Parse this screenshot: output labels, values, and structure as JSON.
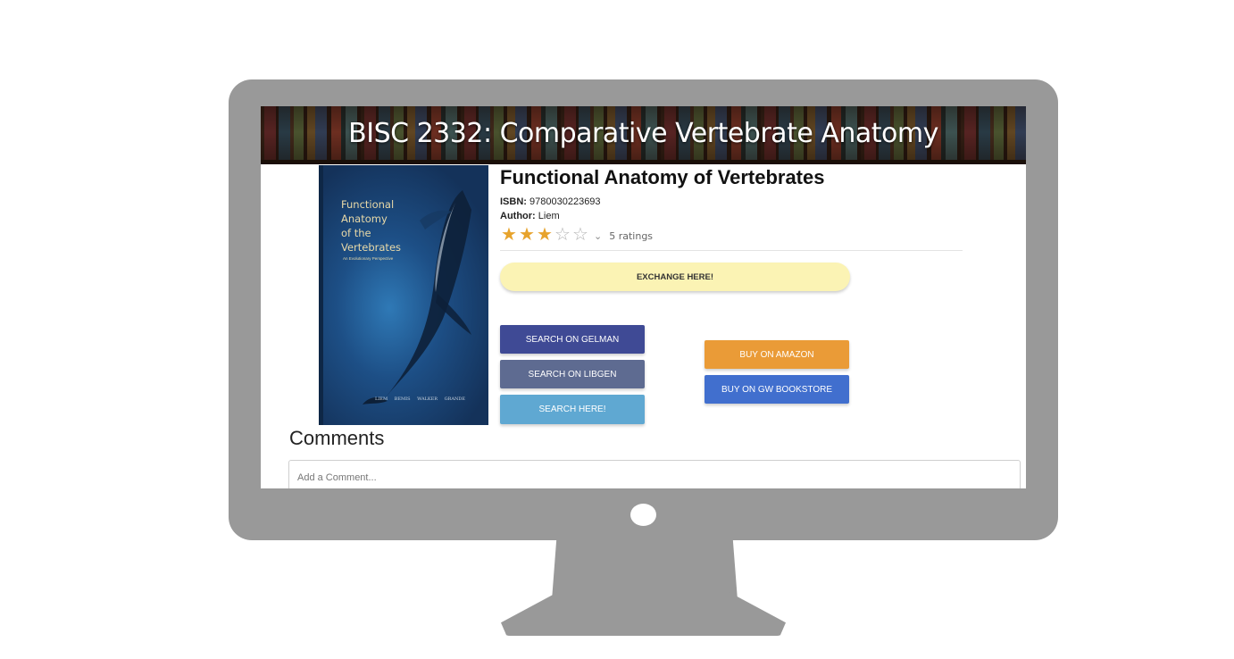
{
  "course": {
    "title": "BISC 2332: Comparative Vertebrate Anatomy"
  },
  "book": {
    "title": "Functional Anatomy of Vertebrates",
    "isbn_label": "ISBN:",
    "isbn": "9780030223693",
    "author_label": "Author:",
    "author": "Liem",
    "cover": {
      "title": "Functional\nAnatomy\nof the\nVertebrates",
      "subtitle": "An Evolutionary Perspective",
      "authors": "LIEM BEMIS WALKER GRANDE",
      "colors": {
        "background": "#1d4f86",
        "text": "#e8d9a8"
      }
    }
  },
  "rating": {
    "value": 3,
    "max": 5,
    "count_text": "5 ratings",
    "filled_color": "#e7a32c"
  },
  "buttons": {
    "exchange": "EXCHANGE HERE!",
    "gelman": "SEARCH ON GELMAN",
    "libgen": "SEARCH ON LIBGEN",
    "search_here": "SEARCH HERE!",
    "amazon": "BUY ON AMAZON",
    "gw_bookstore": "BUY ON GW BOOKSTORE"
  },
  "comments": {
    "heading": "Comments",
    "placeholder": "Add a Comment..."
  },
  "colors": {
    "monitor": "#999999",
    "exchange": "#fbf3b4",
    "gelman": "#3f4a95",
    "libgen": "#5e6b91",
    "search_here": "#5fa8d2",
    "amazon": "#ea9b37",
    "gw_bookstore": "#416fce"
  }
}
